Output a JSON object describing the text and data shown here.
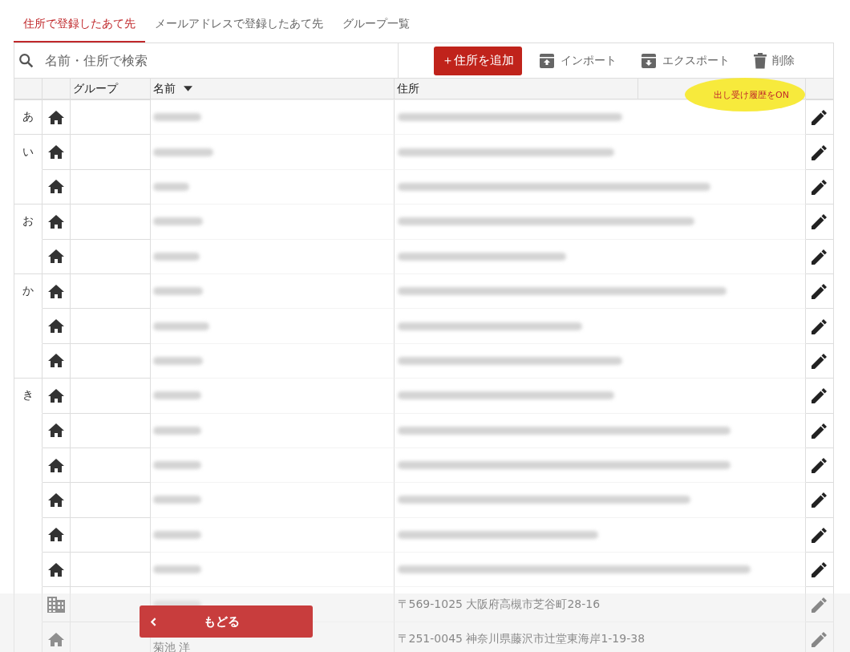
{
  "tabs": [
    {
      "label": "住所で登録したあて先",
      "selected": true
    },
    {
      "label": "メールアドレスで登録したあて先",
      "selected": false
    },
    {
      "label": "グループ一覧",
      "selected": false
    }
  ],
  "search": {
    "placeholder": "名前・住所で検索"
  },
  "toolbar": [
    {
      "kind": "primary",
      "label": "＋住所を追加"
    },
    {
      "kind": "import",
      "label": "インポート"
    },
    {
      "kind": "export",
      "label": "エクスポート"
    },
    {
      "kind": "delete",
      "label": "削除"
    }
  ],
  "columns": [
    "グループ",
    "名前",
    "住所"
  ],
  "highlight": {
    "label": "出し受け履歴をON"
  },
  "rows": [
    {
      "index": "あ",
      "kind": "home"
    },
    {
      "index": "い",
      "kind": "home"
    },
    {
      "kind": "home"
    },
    {
      "index": "お",
      "kind": "home"
    },
    {
      "kind": "home"
    },
    {
      "index": "か",
      "kind": "home"
    },
    {
      "kind": "home"
    },
    {
      "kind": "home"
    },
    {
      "index": "き",
      "kind": "home"
    },
    {
      "kind": "home"
    },
    {
      "kind": "home"
    },
    {
      "kind": "home"
    },
    {
      "kind": "home"
    },
    {
      "kind": "home"
    },
    {
      "kind": "office",
      "address": "〒569-1025 大阪府高槻市芝谷町28-16"
    },
    {
      "kind": "home",
      "name": "菊池 洋",
      "address": "〒251-0045 神奈川県藤沢市辻堂東海岸1-19-38"
    }
  ],
  "back_button": {
    "label": "もどる"
  }
}
